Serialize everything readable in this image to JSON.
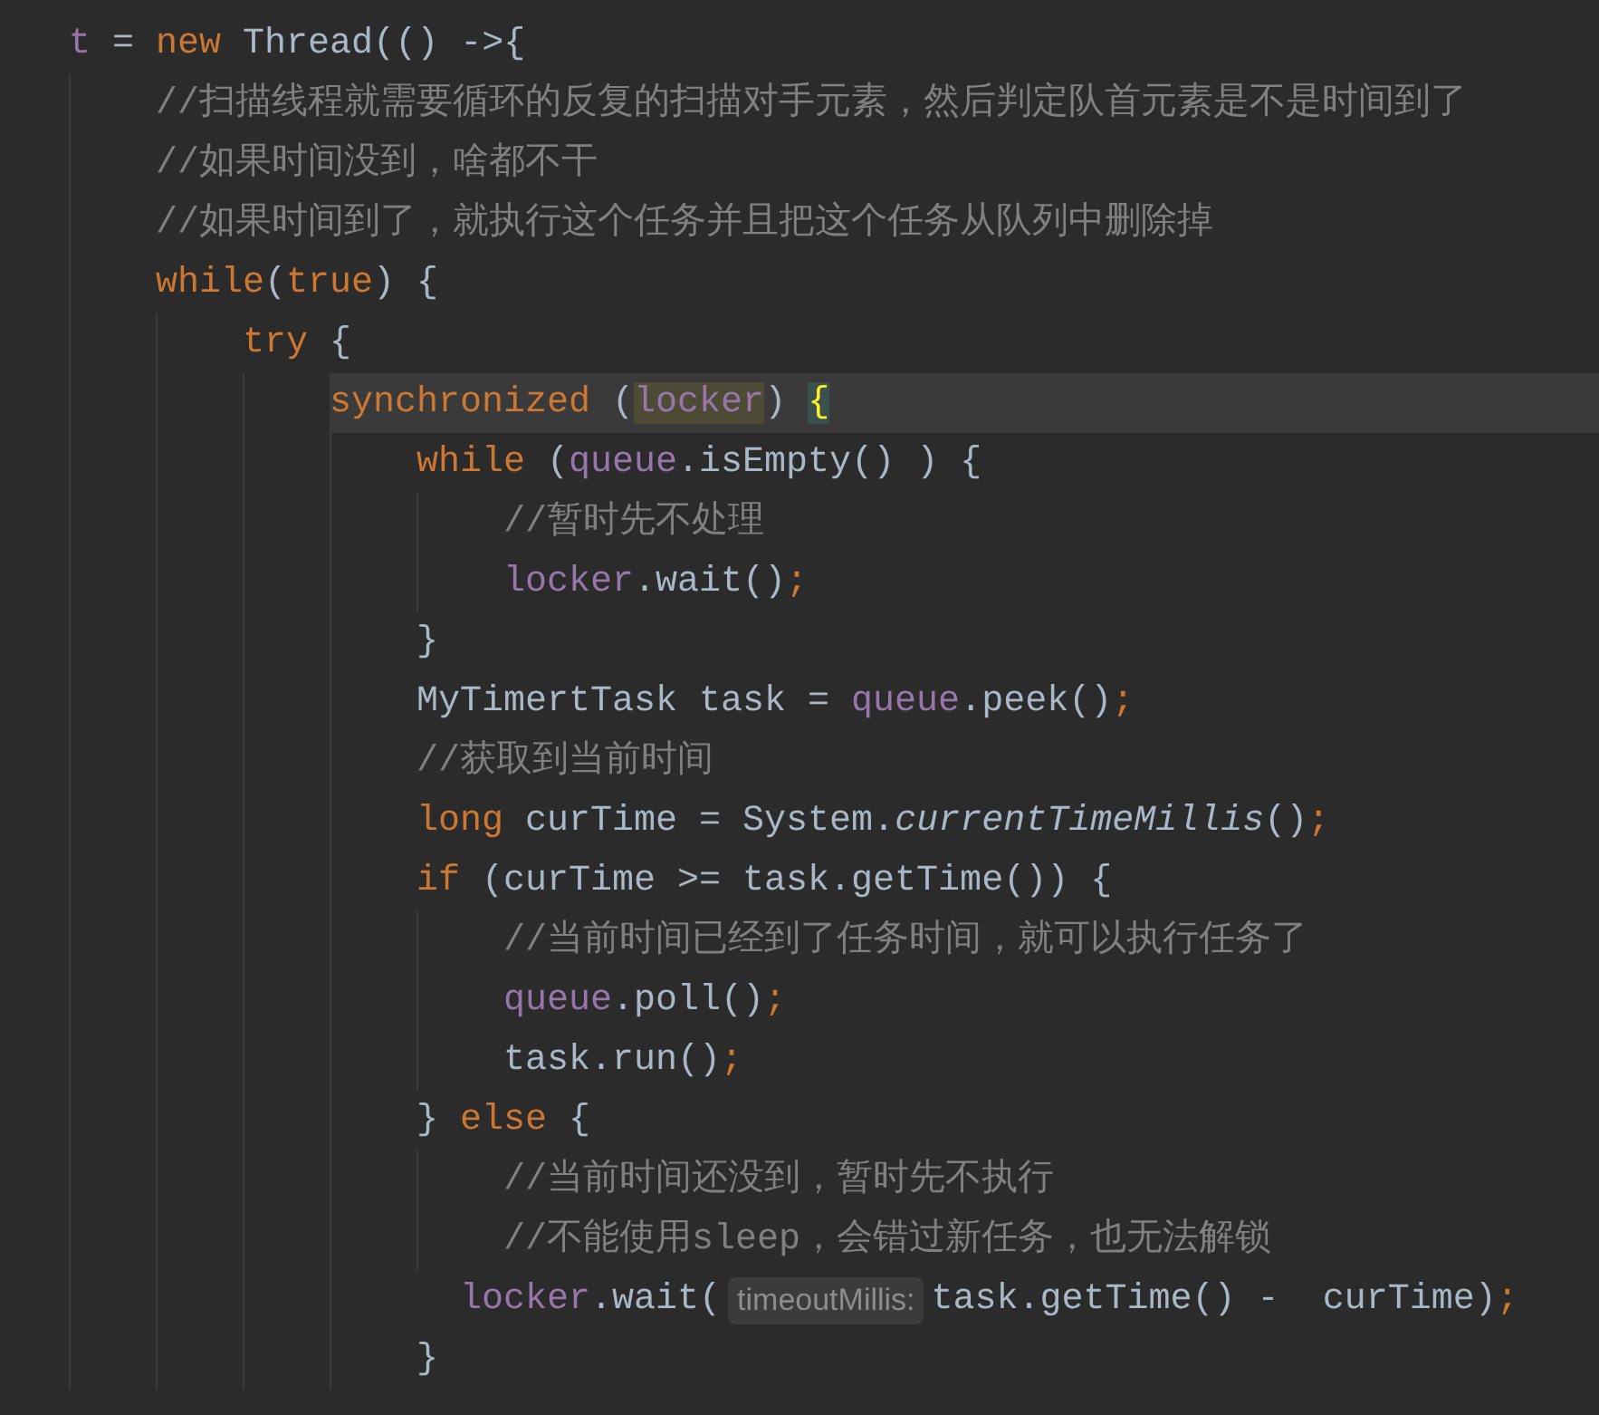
{
  "editor": {
    "lines": [
      {
        "current": false,
        "tokens": [
          {
            "text": "t",
            "kind": "field"
          },
          {
            "text": " = ",
            "kind": "plain"
          },
          {
            "text": "new",
            "kind": "keyword"
          },
          {
            "text": " Thread(() ->{",
            "kind": "plain"
          }
        ],
        "children": [
          {
            "current": false,
            "tokens": [
              {
                "text": "//扫描线程就需要循环的反复的扫描对手元素，然后判定队首元素是不是时间到了",
                "kind": "comment"
              }
            ]
          },
          {
            "current": false,
            "tokens": [
              {
                "text": "//如果时间没到，啥都不干",
                "kind": "comment"
              }
            ]
          },
          {
            "current": false,
            "tokens": [
              {
                "text": "//如果时间到了，就执行这个任务并且把这个任务从队列中删除掉",
                "kind": "comment"
              }
            ]
          },
          {
            "current": false,
            "tokens": [
              {
                "text": "while",
                "kind": "keyword"
              },
              {
                "text": "(",
                "kind": "plain"
              },
              {
                "text": "true",
                "kind": "keyword"
              },
              {
                "text": ") {",
                "kind": "plain"
              }
            ],
            "children": [
              {
                "current": false,
                "tokens": [
                  {
                    "text": "try",
                    "kind": "keyword"
                  },
                  {
                    "text": " {",
                    "kind": "plain"
                  }
                ],
                "children": [
                  {
                    "current": true,
                    "tokens": [
                      {
                        "text": "synchronized",
                        "kind": "keyword"
                      },
                      {
                        "text": " (",
                        "kind": "plain"
                      },
                      {
                        "text": "locker",
                        "kind": "usage"
                      },
                      {
                        "text": ") ",
                        "kind": "plain"
                      },
                      {
                        "text": "{",
                        "kind": "brace_match"
                      }
                    ],
                    "children": [
                      {
                        "current": false,
                        "tokens": [
                          {
                            "text": "while",
                            "kind": "keyword"
                          },
                          {
                            "text": " (",
                            "kind": "plain"
                          },
                          {
                            "text": "queue",
                            "kind": "field"
                          },
                          {
                            "text": ".isEmpty() ) {",
                            "kind": "plain"
                          }
                        ],
                        "children": [
                          {
                            "current": false,
                            "tokens": [
                              {
                                "text": "//暂时先不处理",
                                "kind": "comment"
                              }
                            ]
                          },
                          {
                            "current": false,
                            "tokens": [
                              {
                                "text": "locker",
                                "kind": "field"
                              },
                              {
                                "text": ".wait()",
                                "kind": "plain"
                              },
                              {
                                "text": ";",
                                "kind": "keyword"
                              }
                            ]
                          }
                        ]
                      },
                      {
                        "current": false,
                        "tokens": [
                          {
                            "text": "}",
                            "kind": "plain"
                          }
                        ]
                      },
                      {
                        "current": false,
                        "tokens": [
                          {
                            "text": "MyTimertTask task = ",
                            "kind": "plain"
                          },
                          {
                            "text": "queue",
                            "kind": "field"
                          },
                          {
                            "text": ".peek()",
                            "kind": "plain"
                          },
                          {
                            "text": ";",
                            "kind": "keyword"
                          }
                        ]
                      },
                      {
                        "current": false,
                        "tokens": [
                          {
                            "text": "//获取到当前时间",
                            "kind": "comment"
                          }
                        ]
                      },
                      {
                        "current": false,
                        "tokens": [
                          {
                            "text": "long",
                            "kind": "keyword"
                          },
                          {
                            "text": " curTime = System.",
                            "kind": "plain"
                          },
                          {
                            "text": "currentTimeMillis",
                            "kind": "static"
                          },
                          {
                            "text": "()",
                            "kind": "plain"
                          },
                          {
                            "text": ";",
                            "kind": "keyword"
                          }
                        ]
                      },
                      {
                        "current": false,
                        "tokens": [
                          {
                            "text": "if",
                            "kind": "keyword"
                          },
                          {
                            "text": " (curTime >= task.getTime()) {",
                            "kind": "plain"
                          }
                        ],
                        "children": [
                          {
                            "current": false,
                            "tokens": [
                              {
                                "text": "//当前时间已经到了任务时间，就可以执行任务了",
                                "kind": "comment"
                              }
                            ]
                          },
                          {
                            "current": false,
                            "tokens": [
                              {
                                "text": "queue",
                                "kind": "field"
                              },
                              {
                                "text": ".poll()",
                                "kind": "plain"
                              },
                              {
                                "text": ";",
                                "kind": "keyword"
                              }
                            ]
                          },
                          {
                            "current": false,
                            "tokens": [
                              {
                                "text": "task.run()",
                                "kind": "plain"
                              },
                              {
                                "text": ";",
                                "kind": "keyword"
                              }
                            ]
                          }
                        ]
                      },
                      {
                        "current": false,
                        "tokens": [
                          {
                            "text": "} ",
                            "kind": "plain"
                          },
                          {
                            "text": "else",
                            "kind": "keyword"
                          },
                          {
                            "text": " {",
                            "kind": "plain"
                          }
                        ],
                        "children": [
                          {
                            "current": false,
                            "tokens": [
                              {
                                "text": "//当前时间还没到，暂时先不执行",
                                "kind": "comment"
                              }
                            ]
                          },
                          {
                            "current": false,
                            "tokens": [
                              {
                                "text": "//不能使用sleep，会错过新任务，也无法解锁",
                                "kind": "comment"
                              }
                            ]
                          }
                        ]
                      },
                      {
                        "current": false,
                        "tokens": [
                          {
                            "text": "  locker",
                            "kind": "field"
                          },
                          {
                            "text": ".wait(",
                            "kind": "plain"
                          },
                          {
                            "text": "timeoutMillis:",
                            "kind": "hint"
                          },
                          {
                            "text": "task.getTime() -  curTime)",
                            "kind": "plain"
                          },
                          {
                            "text": ";",
                            "kind": "keyword"
                          }
                        ]
                      },
                      {
                        "current": false,
                        "tokens": [
                          {
                            "text": "}",
                            "kind": "plain"
                          }
                        ]
                      }
                    ]
                  }
                ]
              }
            ]
          }
        ]
      }
    ]
  }
}
